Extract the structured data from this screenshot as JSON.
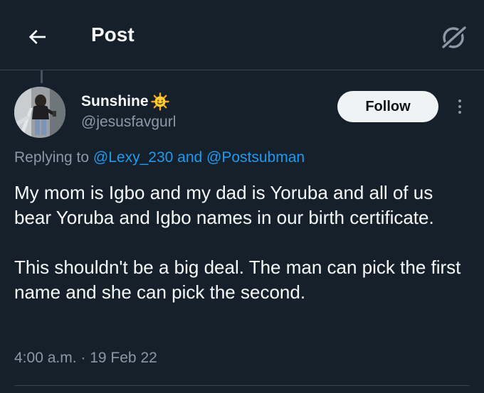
{
  "header": {
    "title": "Post",
    "back_icon": "arrow-left-icon",
    "grok_icon": "grok-slash-circle-icon"
  },
  "tweet": {
    "author": {
      "display_name": "Sunshine",
      "emoji": "smiling-sun-emoji",
      "handle": "@jesusfavgurl"
    },
    "follow_label": "Follow",
    "more_icon": "more-vertical-icon",
    "replying": {
      "prefix": "Replying to ",
      "user1": "@Lexy_230",
      "conjunction": " and ",
      "user2": "@Postsubman"
    },
    "text": {
      "paragraph1": "My mom is Igbo and my dad is Yoruba and all of us bear Yoruba and Igbo names in our birth certificate.",
      "paragraph2": "This shouldn't be a big deal. The man can pick the first name and she can pick the second."
    },
    "time": "4:00 a.m.",
    "separator": " · ",
    "date": "19 Feb 22"
  },
  "colors": {
    "background": "#15202b",
    "text_primary": "#f7f9f9",
    "text_secondary": "#8b98a5",
    "link": "#1d9bf0",
    "divider": "#38444d",
    "follow_bg": "#eff3f4"
  }
}
